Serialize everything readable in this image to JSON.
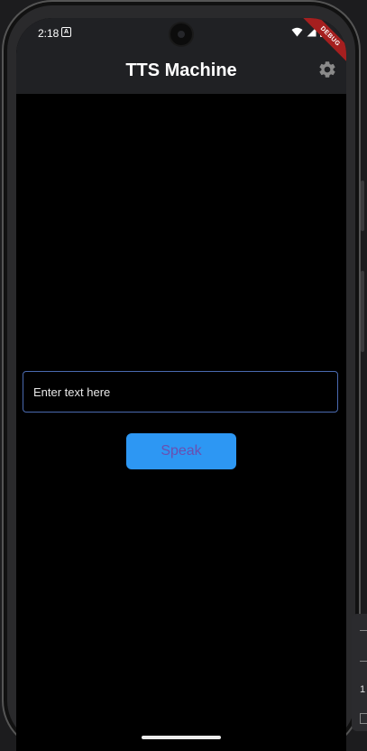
{
  "status_bar": {
    "time": "2:18",
    "notification_icon": "A",
    "icons": [
      "wifi-icon",
      "signal-icon",
      "battery-icon"
    ]
  },
  "app_bar": {
    "title": "TTS Machine",
    "settings_icon": "gear-icon",
    "debug_label": "DEBUG"
  },
  "main": {
    "input": {
      "placeholder": "Enter text here",
      "value": ""
    },
    "speak_button": {
      "label": "Speak"
    }
  },
  "side_panel": {
    "number": "1"
  },
  "colors": {
    "app_bar_bg": "#202124",
    "background": "#000000",
    "button_bg": "#2D97F3",
    "button_text": "#6A4FB0",
    "input_border": "#4A6AB0",
    "debug_ribbon": "#A51F1F"
  }
}
